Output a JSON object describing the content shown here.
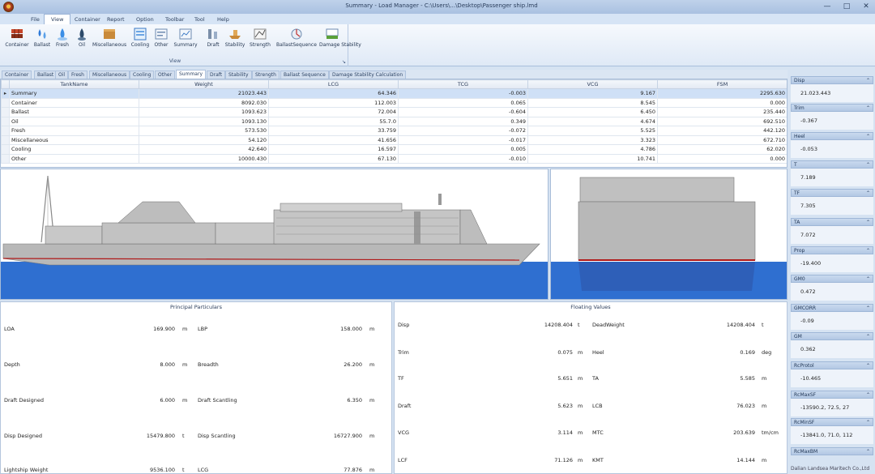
{
  "window": {
    "title": "Summary - Load Manager - C:\\Users\\...\\Desktop\\Passenger ship.lmd",
    "minimize": "—",
    "maximize": "□",
    "close": "✕"
  },
  "menu": [
    "File",
    "View",
    "Container",
    "Report",
    "Option",
    "Toolbar",
    "Tool",
    "Help"
  ],
  "menu_active": "View",
  "ribbon": {
    "buttons": [
      {
        "label": "Container",
        "icon": "container-icon"
      },
      {
        "label": "Ballast",
        "icon": "ballast-icon"
      },
      {
        "label": "Fresh",
        "icon": "fresh-water-icon"
      },
      {
        "label": "Oil",
        "icon": "oil-icon"
      },
      {
        "label": "Miscellaneous",
        "icon": "miscellaneous-icon"
      },
      {
        "label": "Cooling",
        "icon": "cooling-icon"
      },
      {
        "label": "Other",
        "icon": "other-icon"
      },
      {
        "label": "Summary",
        "icon": "summary-icon"
      },
      {
        "label": "Draft",
        "icon": "draft-icon"
      },
      {
        "label": "Stability",
        "icon": "stability-icon"
      },
      {
        "label": "Strength",
        "icon": "strength-icon"
      },
      {
        "label": "BallastSequence",
        "icon": "ballast-sequence-icon"
      },
      {
        "label": "Damage Stability",
        "icon": "damage-stability-icon"
      }
    ],
    "group_label": "View",
    "launcher": "↘"
  },
  "tabs": [
    "Container",
    "Ballast",
    "Oil",
    "Fresh",
    "Miscellaneous",
    "Cooling",
    "Other",
    "Summary",
    "Draft",
    "Stability",
    "Strength",
    "Ballast Sequence",
    "Damage Stability Calculation"
  ],
  "active_tab": "Summary",
  "grid": {
    "columns": [
      "TankName",
      "Weight",
      "LCG",
      "TCG",
      "VCG",
      "FSM"
    ],
    "rows": [
      {
        "marker": "▸",
        "name": "Summary",
        "weight": "21023.443",
        "lcg": "64.346",
        "tcg": "-0.003",
        "vcg": "9.167",
        "fsm": "2295.630",
        "selected": true
      },
      {
        "marker": "",
        "name": "Container",
        "weight": "8092.030",
        "lcg": "112.003",
        "tcg": "0.065",
        "vcg": "8.545",
        "fsm": "0.000",
        "selected": false
      },
      {
        "marker": "",
        "name": "Ballast",
        "weight": "1093.623",
        "lcg": "72.004",
        "tcg": "-0.604",
        "vcg": "6.450",
        "fsm": "235.440",
        "selected": false
      },
      {
        "marker": "",
        "name": "Oil",
        "weight": "1093.130",
        "lcg": "55.7.0",
        "tcg": "0.349",
        "vcg": "4.674",
        "fsm": "692.510",
        "selected": false
      },
      {
        "marker": "",
        "name": "Fresh",
        "weight": "573.530",
        "lcg": "33.759",
        "tcg": "-0.072",
        "vcg": "5.525",
        "fsm": "442.120",
        "selected": false
      },
      {
        "marker": "",
        "name": "Miscellaneous",
        "weight": "54.120",
        "lcg": "41.656",
        "tcg": "-0.017",
        "vcg": "3.323",
        "fsm": "672.710",
        "selected": false
      },
      {
        "marker": "",
        "name": "Cooling",
        "weight": "42.640",
        "lcg": "16.597",
        "tcg": "0.005",
        "vcg": "4.786",
        "fsm": "62.020",
        "selected": false
      },
      {
        "marker": "",
        "name": "Other",
        "weight": "10000.430",
        "lcg": "67.130",
        "tcg": "-0.010",
        "vcg": "10.741",
        "fsm": "0.000",
        "selected": false
      }
    ]
  },
  "principal": {
    "title": "Principal Particulars",
    "left": [
      {
        "label": "LOA",
        "value": "169.900",
        "unit": "m"
      },
      {
        "label": "Depth",
        "value": "8.000",
        "unit": "m"
      },
      {
        "label": "Draft Designed",
        "value": "6.000",
        "unit": "m"
      },
      {
        "label": "Disp Designed",
        "value": "15479.800",
        "unit": "t"
      },
      {
        "label": "Lightship Weight",
        "value": "9536.100",
        "unit": "t"
      }
    ],
    "right": [
      {
        "label": "LBP",
        "value": "158.000",
        "unit": "m"
      },
      {
        "label": "Breadth",
        "value": "26.200",
        "unit": "m"
      },
      {
        "label": "Draft Scantling",
        "value": "6.350",
        "unit": "m"
      },
      {
        "label": "Disp Scantling",
        "value": "16727.900",
        "unit": "m"
      },
      {
        "label": "LCG",
        "value": "77.876",
        "unit": "m"
      }
    ]
  },
  "floating": {
    "title": "Floating Values",
    "left": [
      {
        "label": "Disp",
        "value": "14208.404",
        "unit": "t"
      },
      {
        "label": "Trim",
        "value": "0.075",
        "unit": "m"
      },
      {
        "label": "TF",
        "value": "5.651",
        "unit": "m"
      },
      {
        "label": "Draft",
        "value": "5.623",
        "unit": "m"
      },
      {
        "label": "VCG",
        "value": "3.114",
        "unit": "m"
      },
      {
        "label": "LCF",
        "value": "71.126",
        "unit": "m"
      }
    ],
    "right": [
      {
        "label": "DeadWeight",
        "value": "14208.404",
        "unit": "t"
      },
      {
        "label": "Heel",
        "value": "0.169",
        "unit": "deg"
      },
      {
        "label": "TA",
        "value": "5.585",
        "unit": "m"
      },
      {
        "label": "LCB",
        "value": "76.023",
        "unit": "m"
      },
      {
        "label": "MTC",
        "value": "203.639",
        "unit": "tm/cm"
      },
      {
        "label": "KMT",
        "value": "14.144",
        "unit": "m"
      }
    ]
  },
  "side_panel": [
    {
      "label": "Disp",
      "value": "21.023.443"
    },
    {
      "label": "Trim",
      "value": "-0.367"
    },
    {
      "label": "Heel",
      "value": "-0.053"
    },
    {
      "label": "T",
      "value": "7.189"
    },
    {
      "label": "TF",
      "value": "7.305"
    },
    {
      "label": "TA",
      "value": "7.072"
    },
    {
      "label": "Prop",
      "value": "-19.400"
    },
    {
      "label": "GM0",
      "value": "0.472"
    },
    {
      "label": "GMCORR",
      "value": "-0.09"
    },
    {
      "label": "GM",
      "value": "0.362"
    },
    {
      "label": "RcProtol",
      "value": "-10.465"
    },
    {
      "label": "RcMaxSF",
      "value": "-13590.2, 72.5, 27"
    },
    {
      "label": "RcMinSF",
      "value": "-13841.0, 71.0, 112"
    },
    {
      "label": "RcMaxBM",
      "value": ""
    }
  ],
  "side_panel_chevron": "⌃",
  "footer": "Dalian Landsea Maritech Co.,Ltd",
  "colors": {
    "sea": "#2f6fd0",
    "hull": "#b8b8b8",
    "waterline": "#b01818",
    "accent": "#cfe0f6"
  }
}
